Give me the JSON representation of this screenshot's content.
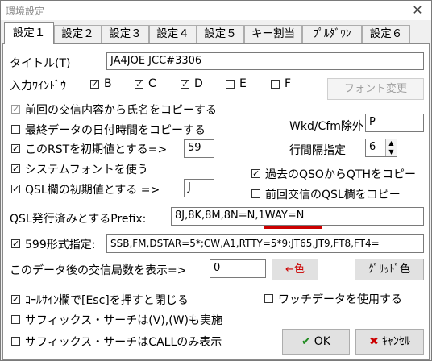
{
  "window": {
    "title": "環境設定",
    "close": "✕"
  },
  "tabs": [
    "設定１",
    "設定２",
    "設定３",
    "設定４",
    "設定５",
    "キー割当",
    "ﾌﾟﾙﾀﾞｳﾝ",
    "設定６"
  ],
  "title_field": {
    "label": "タイトル(T)",
    "value": "JA4JOE JCC#3306"
  },
  "input_window": {
    "label": "入力ｳｲﾝﾄﾞｳ",
    "options": [
      {
        "label": "B",
        "checked": true
      },
      {
        "label": "C",
        "checked": true
      },
      {
        "label": "D",
        "checked": true
      },
      {
        "label": "E",
        "checked": false
      },
      {
        "label": "F",
        "checked": false
      }
    ]
  },
  "font_button": "フォント変更",
  "copy_name": {
    "label": "前回の交信内容から氏名をコピーする",
    "checked": true
  },
  "copy_datetime": {
    "label": "最終データの日付時間をコピーする",
    "checked": false
  },
  "wkd_label": "Wkd/Cfm除外",
  "wkd_value": "P",
  "rst": {
    "label": "このRSTを初期値とする=>",
    "checked": true,
    "value": "59"
  },
  "line_spacing": {
    "label": "行間隔指定",
    "value": "6"
  },
  "system_font": {
    "label": "システムフォントを使う",
    "checked": true
  },
  "copy_qth": {
    "label": "過去のQSOからQTHをコピー",
    "checked": true
  },
  "qsl_init": {
    "label": "QSL欄の初期値とする =>",
    "checked": true,
    "value": "J"
  },
  "copy_qsl": {
    "label": "前回交信のQSL欄をコピー",
    "checked": false
  },
  "qsl_prefix": {
    "label": "QSL発行済みとするPrefix:",
    "value": "8J,8K,8M,8N=N,1WAY=N"
  },
  "format599": {
    "label": "599形式指定:",
    "checked": true,
    "value": "SSB,FM,DSTAR=5*;CW,A1,RTTY=5*9;JT65,JT9,FT8,FT4="
  },
  "qso_count": {
    "label": "このデータ後の交信局数を表示=>",
    "value": "0"
  },
  "color_button": "←色",
  "grid_color_button": "ｸﾞﾘｯﾄﾞ色",
  "esc_close": {
    "label": "ｺｰﾙｻｲﾝ欄で[Esc]を押すと閉じる",
    "checked": true
  },
  "watch_data": {
    "label": "ワッチデータを使用する",
    "checked": false
  },
  "suffix_vw": {
    "label": "サフィックス・サーチは(V),(W)も実施",
    "checked": false
  },
  "suffix_call": {
    "label": "サフィックス・サーチはCALLのみ表示",
    "checked": false
  },
  "ok_button": "OK",
  "cancel_button": "ｷｬﾝｾﾙ",
  "colors": {
    "red_accent": "#cc0000",
    "ok_green": "#1f8a1f",
    "cancel_red": "#cc0000"
  }
}
